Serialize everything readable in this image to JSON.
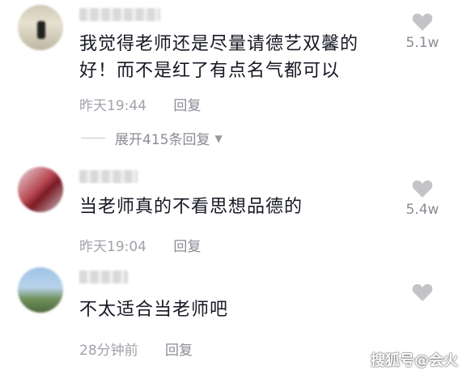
{
  "comments": [
    {
      "text_lines": [
        "我觉得老师还是尽量请德艺双馨的",
        "好！而不是红了有点名气都可以"
      ],
      "time": "昨天19:44",
      "reply_label": "回复",
      "likes": "5.1w",
      "expand_label": "展开415条回复"
    },
    {
      "text_lines": [
        "当老师真的不看思想品德的"
      ],
      "time": "昨天19:04",
      "reply_label": "回复",
      "likes": "5.4w"
    },
    {
      "text_lines": [
        "不太适合当老师吧"
      ],
      "time": "28分钟前",
      "reply_label": "回复",
      "likes": ""
    }
  ],
  "watermark": "搜狐号@会火",
  "icons": {
    "like": "heart-icon",
    "expand": "triangle-down-icon"
  },
  "colors": {
    "meta": "#a0a3aa",
    "heart": "#c4c4c8",
    "text": "#161823"
  }
}
